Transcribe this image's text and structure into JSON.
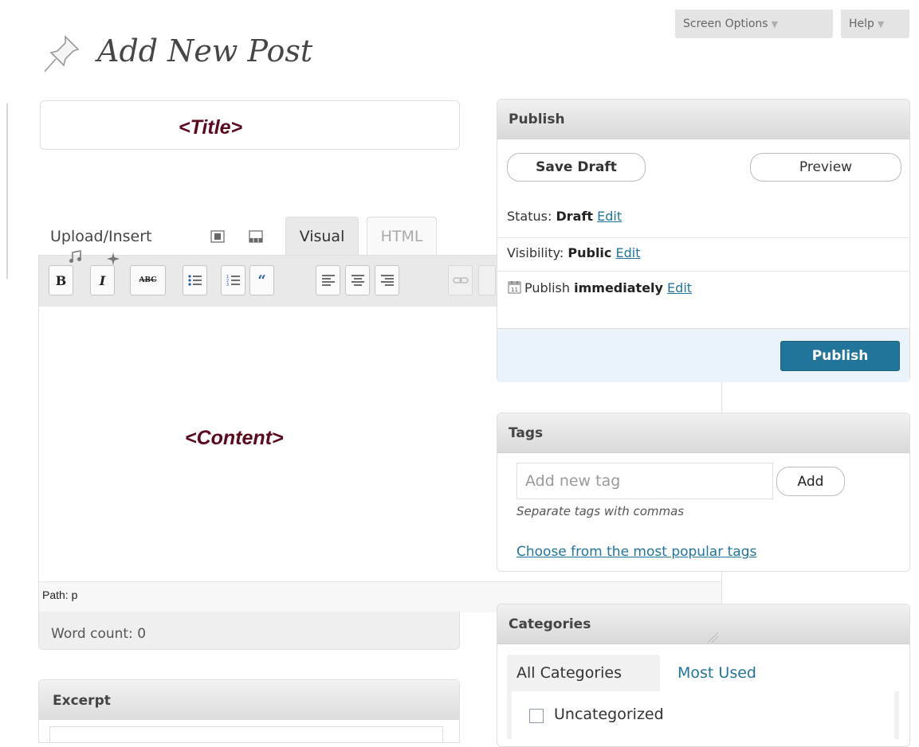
{
  "screen_options": {
    "label": "Screen Options",
    "arrow": "▼"
  },
  "help": {
    "label": "Help",
    "arrow": "▼"
  },
  "page_title": "Add New Post",
  "title_field": {
    "marker": "<Title>"
  },
  "editor": {
    "upload_insert_label": "Upload/Insert",
    "tabs": {
      "visual": "Visual",
      "html": "HTML"
    },
    "toolbar": {
      "bold": "B",
      "italic": "I",
      "strike": "ABC"
    },
    "content_marker": "<Content>",
    "path": "Path: p",
    "word_count": "Word count: 0"
  },
  "excerpt": {
    "title": "Excerpt"
  },
  "publish": {
    "title": "Publish",
    "save_draft": "Save Draft",
    "preview": "Preview",
    "status_label": "Status:",
    "status_value": "Draft",
    "visibility_label": "Visibility:",
    "visibility_value": "Public",
    "schedule_label": "Publish",
    "schedule_value": "immediately",
    "edit_link": "Edit",
    "publish_button": "Publish"
  },
  "tags": {
    "title": "Tags",
    "placeholder": "Add new tag",
    "add_button": "Add",
    "hint": "Separate tags with commas",
    "popular_link": "Choose from the most popular tags"
  },
  "categories": {
    "title": "Categories",
    "tabs": [
      "All Categories",
      "Most Used"
    ],
    "items": [
      {
        "label": "Uncategorized",
        "checked": false
      }
    ]
  },
  "colors": {
    "link": "#21759b",
    "publish_button": "#21759b",
    "marker_text": "#5a0a1c",
    "publish_action_bg": "#eaf2fa"
  }
}
